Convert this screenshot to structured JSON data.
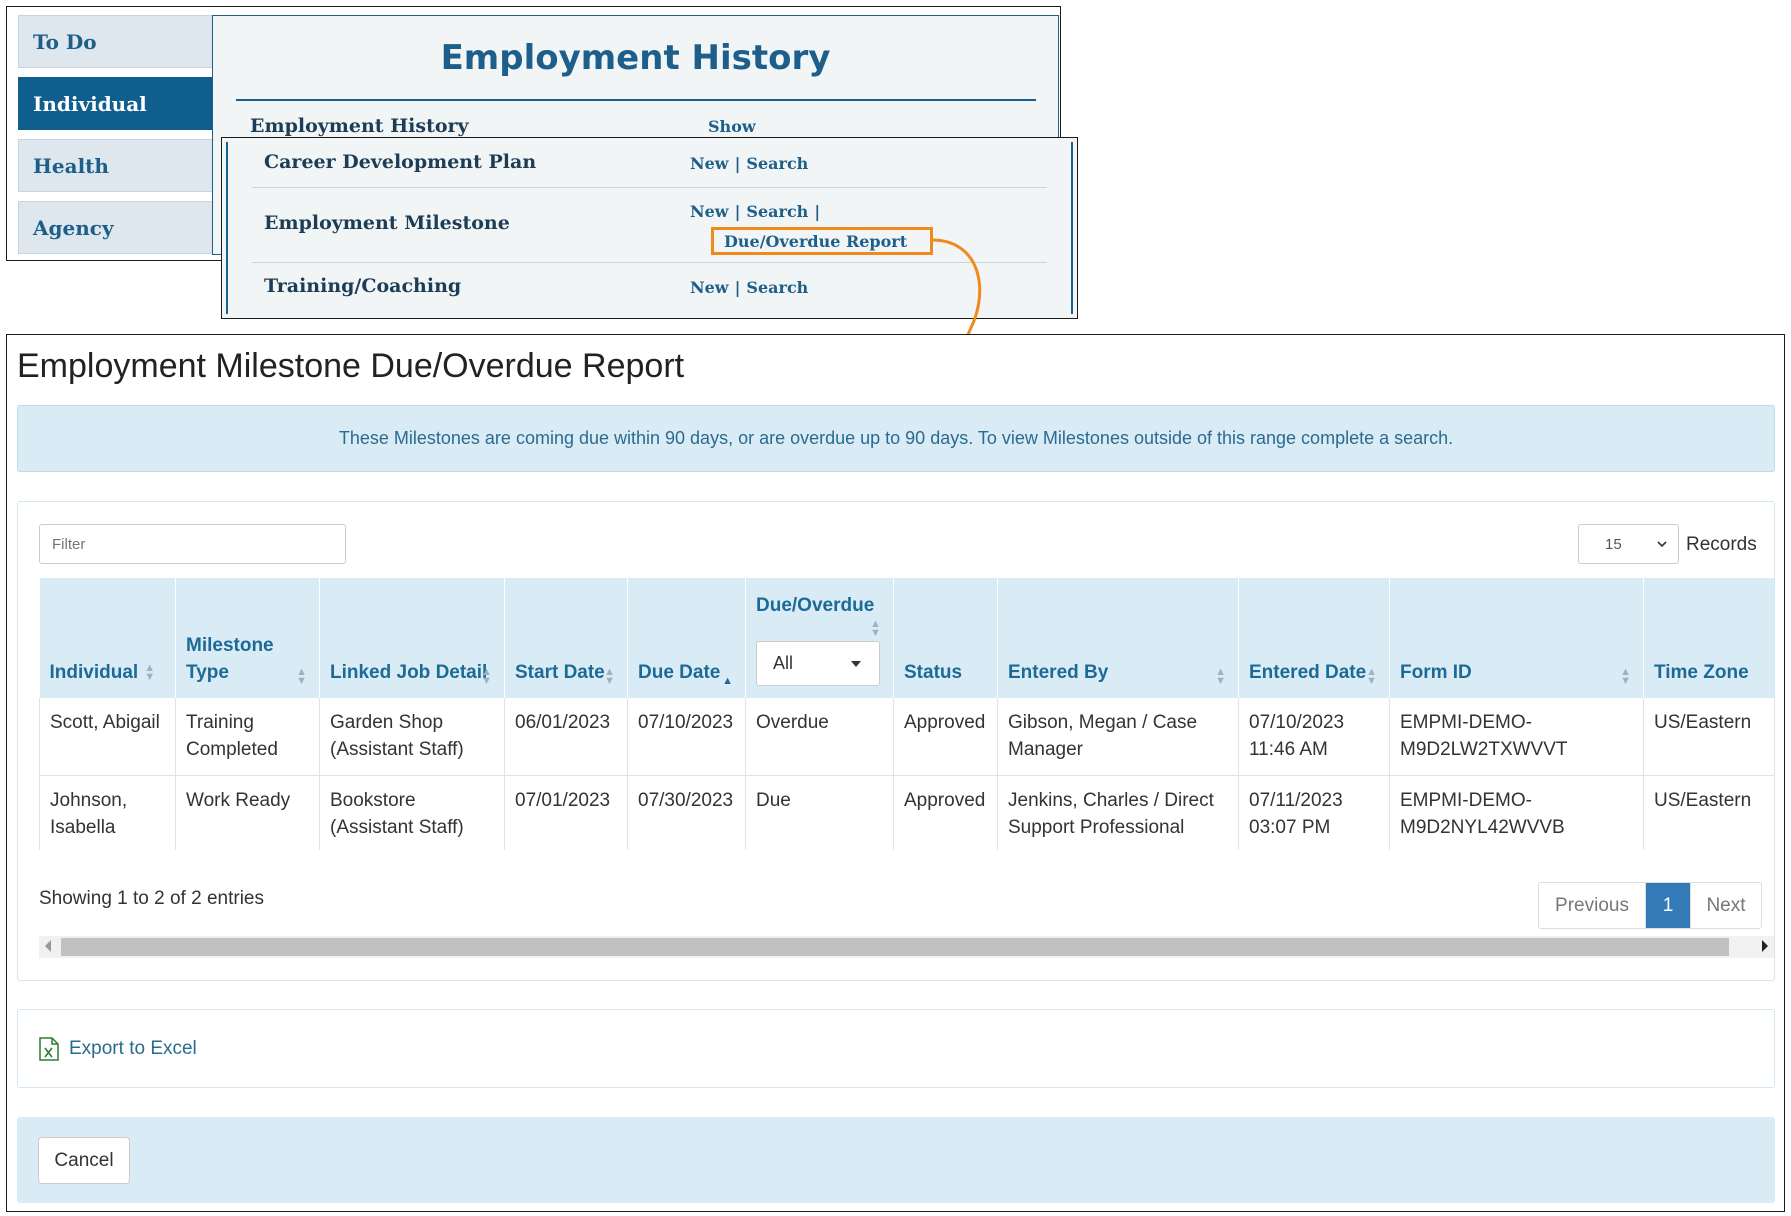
{
  "nav": {
    "tabs": [
      {
        "label": "To Do",
        "active": false
      },
      {
        "label": "Individual",
        "active": true
      },
      {
        "label": "Health",
        "active": false
      },
      {
        "label": "Agency",
        "active": false
      }
    ],
    "section_title": "Employment History",
    "history_row": {
      "label": "Employment History",
      "link": "Show"
    },
    "rows": [
      {
        "label": "Career Development Plan",
        "new": "New",
        "search": "Search",
        "separator": "|"
      },
      {
        "label": "Employment Milestone",
        "new": "New",
        "search": "Search",
        "separator": "|",
        "report": "Due/Overdue Report"
      },
      {
        "label": "Training/Coaching",
        "new": "New",
        "search": "Search",
        "separator": "|"
      }
    ],
    "highlight_color": "#f08a1c"
  },
  "report": {
    "title": "Employment Milestone Due/Overdue Report",
    "info": "These Milestones are coming due within 90 days, or are overdue up to 90 days. To view Milestones outside of this range complete a search.",
    "filter_placeholder": "Filter",
    "records_value": "15",
    "records_label": "Records",
    "columns": [
      "Individual",
      "Milestone Type",
      "Linked Job Detail",
      "Start Date",
      "Due Date",
      "Due/Overdue",
      "Status",
      "Entered By",
      "Entered Date",
      "Form ID",
      "Time Zone"
    ],
    "due_filter_value": "All",
    "rows": [
      [
        "Scott, Abigail",
        "Training Completed",
        "Garden Shop (Assistant Staff)",
        "06/01/2023",
        "07/10/2023",
        "Overdue",
        "Approved",
        "Gibson, Megan / Case Manager",
        "07/10/2023 11:46 AM",
        "EMPMI-DEMO-M9D2LW2TXWVVT",
        "US/Eastern"
      ],
      [
        "Johnson, Isabella",
        "Work Ready",
        "Bookstore (Assistant Staff)",
        "07/01/2023",
        "07/30/2023",
        "Due",
        "Approved",
        "Jenkins, Charles / Direct Support Professional",
        "07/11/2023 03:07 PM",
        "EMPMI-DEMO-M9D2NYL42WVVB",
        "US/Eastern"
      ]
    ],
    "showing": "Showing 1 to 2 of 2 entries",
    "pager": {
      "prev": "Previous",
      "current": "1",
      "next": "Next"
    },
    "export_label": "Export to Excel",
    "cancel_label": "Cancel",
    "accent_color": "#1d6a97",
    "header_bg": "#d9ecf5"
  }
}
